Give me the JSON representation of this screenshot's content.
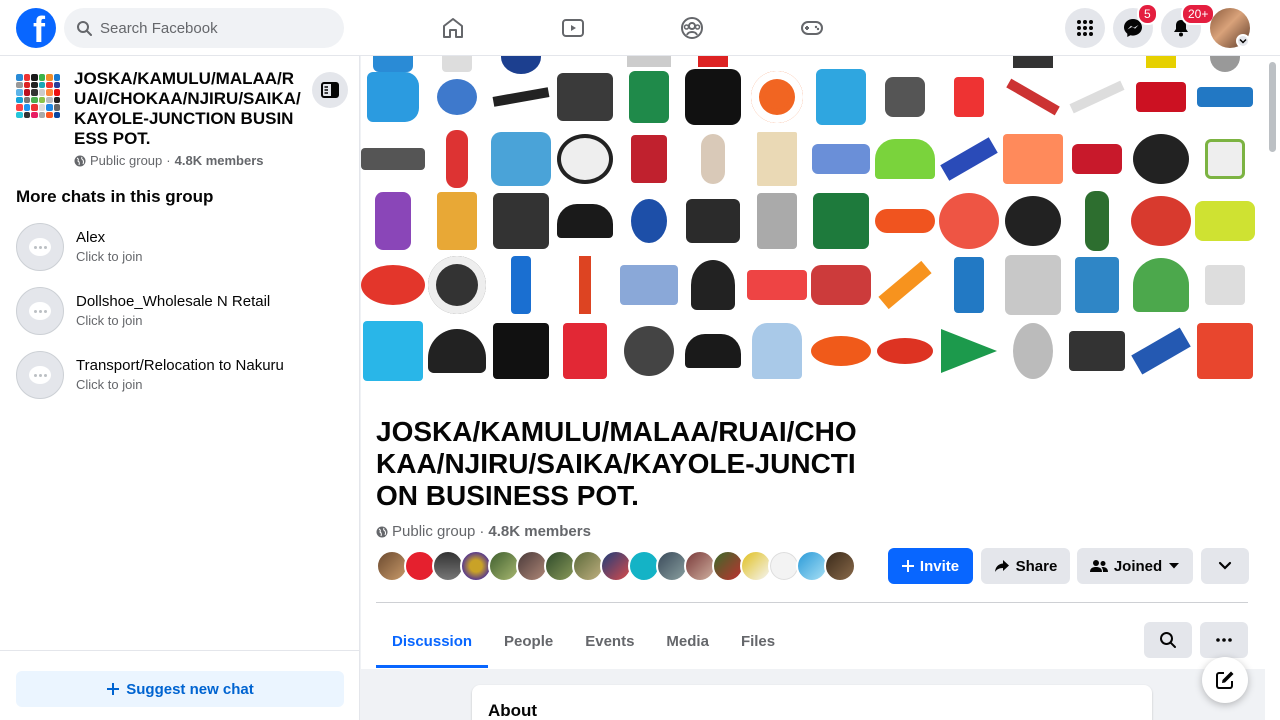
{
  "topbar": {
    "search_placeholder": "Search Facebook",
    "nav": [
      "home-icon",
      "video-icon",
      "groups-icon",
      "gaming-icon"
    ],
    "messenger_badge": "5",
    "notifications_badge": "20+"
  },
  "sidebar": {
    "group_name": "JOSKA/KAMULU/MALAA/RUAI/CHOKAA/NJIRU/SAIKA/KAYOLE-JUNCTION BUSINESS POT.",
    "privacy": "Public group",
    "members": "4.8K members",
    "section_title": "More chats in this group",
    "chats": [
      {
        "name": "Alex",
        "sub": "Click to join"
      },
      {
        "name": "Dollshoe_Wholesale N Retail",
        "sub": "Click to join"
      },
      {
        "name": "Transport/Relocation to Nakuru",
        "sub": "Click to join"
      }
    ],
    "suggest_label": "Suggest new chat"
  },
  "main": {
    "title": "JOSKA/KAMULU/MALAA/RUAI/CHOKAA/NJIRU/SAIKA/KAYOLE-JUNCTION BUSINESS POT.",
    "privacy": "Public group",
    "members": "4.8K members",
    "invite_label": "Invite",
    "share_label": "Share",
    "joined_label": "Joined",
    "tabs": [
      "Discussion",
      "People",
      "Events",
      "Media",
      "Files"
    ],
    "active_tab": "Discussion",
    "about_title": "About"
  },
  "colors": {
    "brand": "#0866ff",
    "badge": "#e41e3f"
  }
}
